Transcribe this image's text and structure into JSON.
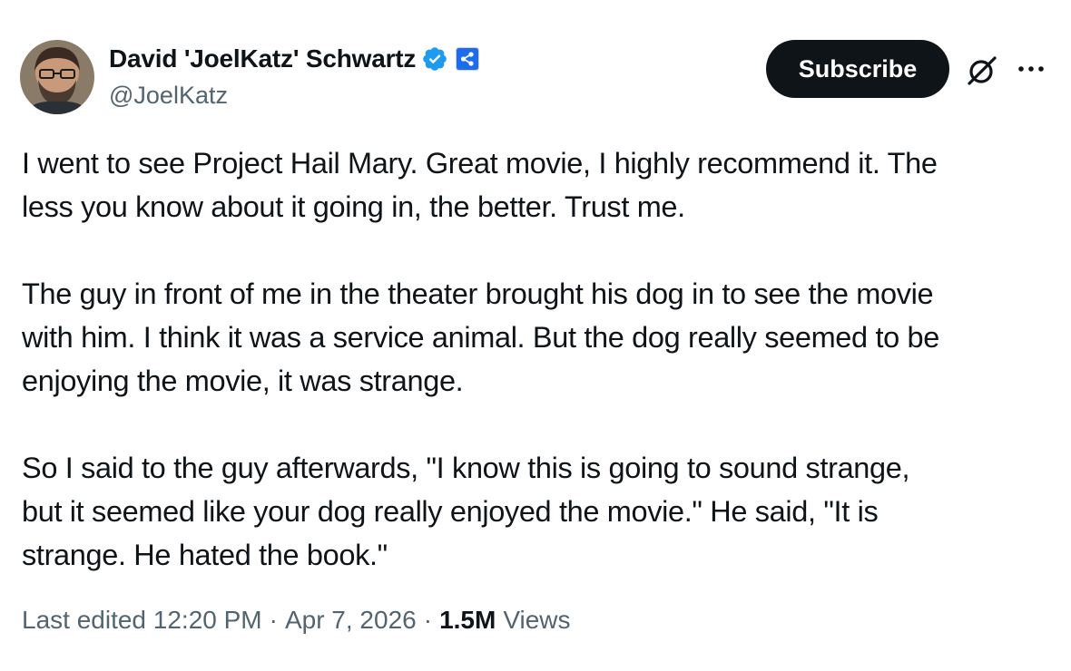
{
  "author": {
    "name": "David 'JoelKatz' Schwartz",
    "handle": "@JoelKatz",
    "verified_icon": "verified-badge-icon",
    "affiliation_icon": "affiliate-logo-icon",
    "verified_color": "#1d9bf0"
  },
  "actions": {
    "subscribe_label": "Subscribe",
    "grok_icon": "grok-icon",
    "more_icon": "more-icon"
  },
  "tweet": {
    "paragraphs": [
      [
        "I went to see Project Hail Mary. Great movie, I highly recommend it. The",
        "less you know about it going in, the better. Trust me."
      ],
      [
        "The guy in front of me in the theater brought his dog in to see the movie",
        "with him. I think it was a service animal. But the dog really seemed to be",
        "enjoying the movie, it was strange."
      ],
      [
        "So I said to the guy afterwards, \"I know this is going to sound strange,",
        "but it seemed like your dog really enjoyed the movie.\" He said, \"It is",
        "strange. He hated the book.\""
      ]
    ]
  },
  "meta": {
    "edited": "Last edited 12:20 PM",
    "separator": "·",
    "date": "Apr 7, 2026",
    "views_count": "1.5M",
    "views_label": "Views"
  }
}
